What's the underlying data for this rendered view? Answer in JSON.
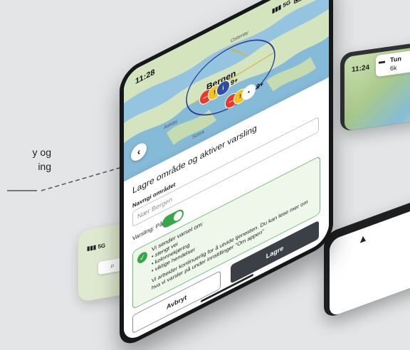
{
  "callout": {
    "line1": "y og",
    "line2": "ing"
  },
  "main_phone": {
    "status": {
      "time": "11:28",
      "network": "5G"
    },
    "map": {
      "places": {
        "osteroy": "Osterøy",
        "bergen": "Bergen",
        "askoy": "Askøy",
        "sotra": "Sotra"
      },
      "clusters": [
        {
          "count": "9+"
        },
        {
          "count": "9+"
        }
      ]
    },
    "sheet": {
      "title": "Lagre område og aktiver varsling",
      "name_label": "Navngi området",
      "name_placeholder": "Nær Bergen",
      "notification_label": "Varsling: På",
      "notification_on": true,
      "info": {
        "intro": "Vi sender varsel om:",
        "items": [
          "• stengt vei",
          "• kolonnekjøring",
          "• viktige hendelser"
        ],
        "more": "Vi arbeider kontinuerlig for å utvide tjenesten. Du kan lese mer om hva vi varsler på under innstillinger \"Om appen\""
      },
      "cancel_label": "Avbryt",
      "save_label": "Lagre"
    }
  },
  "right_phone": {
    "time": "11:24",
    "title": "Tun",
    "sub": "6k"
  },
  "bottom_left_phone": {
    "network": "5G"
  },
  "colors": {
    "accent_green": "#39a64a",
    "dark_button": "#3a4045",
    "water": "#7fb6d8",
    "land": "#cfe2b8"
  },
  "icons": [
    "signal-icon",
    "battery-icon",
    "back-arrow-icon",
    "check-icon",
    "search-icon",
    "bus-icon"
  ]
}
